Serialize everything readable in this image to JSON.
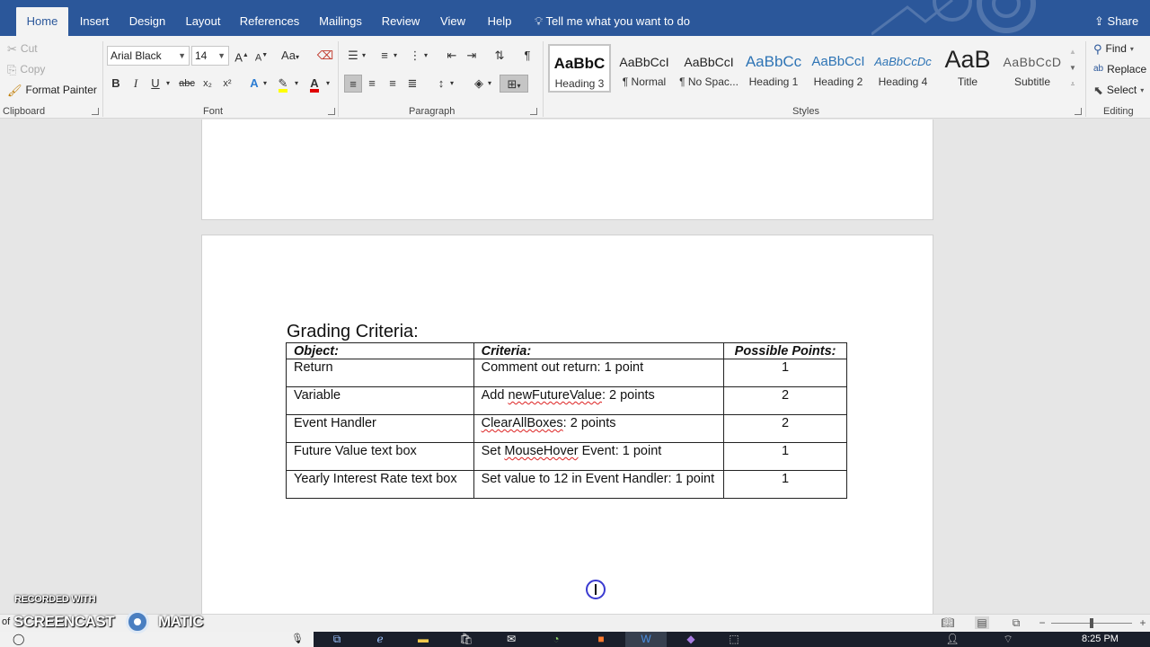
{
  "tabs": [
    {
      "label": "Home",
      "active": true
    },
    {
      "label": "Insert"
    },
    {
      "label": "Design"
    },
    {
      "label": "Layout"
    },
    {
      "label": "References"
    },
    {
      "label": "Mailings"
    },
    {
      "label": "Review"
    },
    {
      "label": "View"
    },
    {
      "label": "Help"
    }
  ],
  "tell_me": "Tell me what you want to do",
  "share_label": "Share",
  "clipboard": {
    "cut": "Cut",
    "copy": "Copy",
    "format_painter": "Format Painter",
    "group_label": "Clipboard"
  },
  "font": {
    "family": "Arial Black",
    "size": "14",
    "case_label": "Aa",
    "group_label": "Font",
    "bold": "B",
    "italic": "I",
    "underline": "U",
    "strike": "abc",
    "subscript": "x₂",
    "superscript": "x²",
    "font_color_glyph": "A",
    "text_effects_glyph": "A"
  },
  "paragraph": {
    "group_label": "Paragraph",
    "pilcrow": "¶"
  },
  "styles": {
    "group_label": "Styles",
    "items": [
      {
        "preview": "AaBbC",
        "name": "Heading 3",
        "selected": true
      },
      {
        "preview": "AaBbCcI",
        "name": "¶ Normal"
      },
      {
        "preview": "AaBbCcI",
        "name": "¶ No Spac..."
      },
      {
        "preview": "AaBbCc",
        "name": "Heading 1"
      },
      {
        "preview": "AaBbCcI",
        "name": "Heading 2"
      },
      {
        "preview": "AaBbCcDc",
        "name": "Heading 4"
      },
      {
        "preview": "AaB",
        "name": "Title"
      },
      {
        "preview": "AaBbCcD",
        "name": "Subtitle"
      }
    ]
  },
  "editing": {
    "find": "Find",
    "replace": "Replace",
    "select": "Select",
    "group_label": "Editing"
  },
  "document": {
    "heading": "Grading Criteria:",
    "table": {
      "headers": [
        "Object:",
        "Criteria:",
        "Possible Points:"
      ],
      "rows": [
        {
          "object": "Return",
          "criteria": "Comment out return: 1 point",
          "points": "1"
        },
        {
          "object": "Variable",
          "criteria_pre": "Add ",
          "criteria_squiggle": "newFutureValue",
          "criteria_post": ": 2 points",
          "points": "2"
        },
        {
          "object": "Event Handler",
          "criteria_pre": "",
          "criteria_squiggle": "ClearAllBoxes",
          "criteria_post": ": 2 points",
          "points": "2"
        },
        {
          "object": "Future Value text box",
          "criteria_pre": "Set ",
          "criteria_squiggle": "MouseHover",
          "criteria_post": " Event: 1 point",
          "points": "1"
        },
        {
          "object": "Yearly Interest Rate text box",
          "criteria": "Set value to 12 in Event Handler: 1 point",
          "points": "1"
        }
      ]
    }
  },
  "watermark": {
    "recorded": "RECORDED WITH",
    "brand_left": "SCREENCAST",
    "brand_right": "MATIC",
    "of_text": "of"
  },
  "clock": "8:25 PM",
  "colors": {
    "accent": "#2b579a",
    "ribbon_bg": "#f3f3f3",
    "doc_bg": "#e6e6e6",
    "squiggle": "#dd2222"
  }
}
